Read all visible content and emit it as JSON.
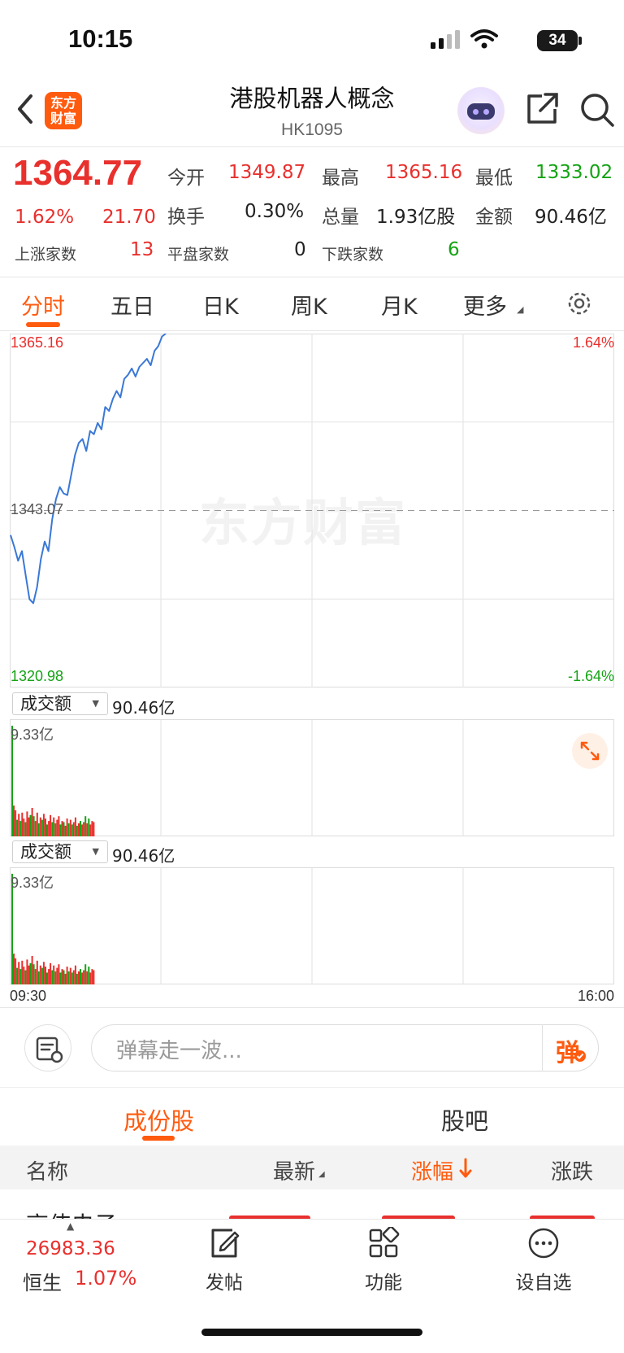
{
  "status_bar": {
    "time": "10:15",
    "battery": "34"
  },
  "header": {
    "logo_text": "东方财富",
    "title": "港股机器人概念",
    "code": "HK1095"
  },
  "quote": {
    "price": "1364.77",
    "change_pct": "1.62%",
    "change": "21.70",
    "open_label": "今开",
    "open": "1349.87",
    "high_label": "最高",
    "high": "1365.16",
    "low_label": "最低",
    "low": "1333.02",
    "turnover_label": "换手",
    "turnover": "0.30%",
    "volume_label": "总量",
    "volume": "1.93亿股",
    "amount_label": "金额",
    "amount": "90.46亿",
    "up_label": "上涨家数",
    "up_count": "13",
    "flat_label": "平盘家数",
    "flat_count": "0",
    "down_label": "下跌家数",
    "down_count": "6"
  },
  "tabs": [
    "分时",
    "五日",
    "日K",
    "周K",
    "月K",
    "更多"
  ],
  "chart_data": {
    "type": "line",
    "ylim": [
      1320.98,
      1365.16
    ],
    "y_top_label": "1365.16",
    "y_mid_label": "1343.07",
    "y_bottom_label": "1320.98",
    "pct_top_label": "1.64%",
    "pct_bottom_label": "-1.64%",
    "x_start_label": "09:30",
    "x_end_label": "16:00",
    "watermark": "东方财富",
    "series": [
      {
        "values": [
          1340.0,
          1338.5,
          1336.8,
          1338.0,
          1335.0,
          1332.0,
          1331.5,
          1333.5,
          1337.0,
          1339.2,
          1338.0,
          1342.0,
          1344.5,
          1346.0,
          1345.2,
          1345.0,
          1347.5,
          1350.0,
          1351.5,
          1352.0,
          1350.5,
          1353.0,
          1352.6,
          1354.0,
          1353.2,
          1356.0,
          1355.5,
          1357.0,
          1358.0,
          1357.2,
          1359.5,
          1360.0,
          1360.8,
          1359.8,
          1361.0,
          1361.5,
          1362.0,
          1361.2,
          1363.0,
          1363.6,
          1364.8,
          1365.16
        ]
      }
    ],
    "volume_panels": [
      {
        "selector": "成交额",
        "total": "90.46亿",
        "max_label": "9.33亿",
        "bars": [
          9.33,
          2.6,
          2.2,
          1.4,
          1.9,
          1.3,
          2.0,
          1.5,
          1.2,
          2.1,
          1.6,
          1.8,
          2.4,
          1.7,
          1.3,
          2.0,
          1.1,
          1.6,
          1.4,
          1.9,
          1.5,
          1.0,
          1.3,
          1.8,
          1.2,
          1.6,
          1.1,
          1.4,
          1.7,
          1.0,
          1.3,
          1.2,
          0.9,
          1.5,
          1.1,
          1.4,
          1.0,
          1.2,
          1.6,
          0.9,
          1.1,
          1.3,
          1.0,
          1.2,
          1.7,
          1.1,
          1.5,
          1.0,
          1.3,
          1.2
        ],
        "bar_colors": [
          "g",
          "r",
          "r",
          "g",
          "r",
          "g",
          "r",
          "r",
          "g",
          "r",
          "r",
          "g",
          "r",
          "g",
          "r",
          "r",
          "g",
          "r",
          "g",
          "r",
          "r",
          "g",
          "r",
          "r",
          "g",
          "r",
          "g",
          "r",
          "r",
          "g",
          "r",
          "g",
          "r",
          "r",
          "g",
          "r",
          "g",
          "r",
          "r",
          "g",
          "r",
          "g",
          "r",
          "r",
          "g",
          "r",
          "g",
          "r",
          "r",
          "r"
        ]
      },
      {
        "selector": "成交额",
        "total": "90.46亿",
        "max_label": "9.33亿",
        "bars": [
          9.33,
          2.6,
          2.2,
          1.4,
          1.9,
          1.3,
          2.0,
          1.5,
          1.2,
          2.1,
          1.6,
          1.8,
          2.4,
          1.7,
          1.3,
          2.0,
          1.1,
          1.6,
          1.4,
          1.9,
          1.5,
          1.0,
          1.3,
          1.8,
          1.2,
          1.6,
          1.1,
          1.4,
          1.7,
          1.0,
          1.3,
          1.2,
          0.9,
          1.5,
          1.1,
          1.4,
          1.0,
          1.2,
          1.6,
          0.9,
          1.1,
          1.3,
          1.0,
          1.2,
          1.7,
          1.1,
          1.5,
          1.0,
          1.3,
          1.2
        ],
        "bar_colors": [
          "g",
          "r",
          "r",
          "g",
          "r",
          "g",
          "r",
          "r",
          "g",
          "r",
          "r",
          "g",
          "r",
          "g",
          "r",
          "r",
          "g",
          "r",
          "g",
          "r",
          "r",
          "g",
          "r",
          "r",
          "g",
          "r",
          "g",
          "r",
          "r",
          "g",
          "r",
          "g",
          "r",
          "r",
          "g",
          "r",
          "g",
          "r",
          "r",
          "g",
          "r",
          "g",
          "r",
          "r",
          "g",
          "r",
          "g",
          "r",
          "r",
          "r"
        ]
      }
    ]
  },
  "danmu": {
    "placeholder": "弹幕走一波...",
    "button": "弹"
  },
  "section_tabs": [
    "成份股",
    "股吧"
  ],
  "table": {
    "headers": [
      "名称",
      "最新",
      "涨幅",
      "涨跌"
    ],
    "first_row_name": "高伟电子"
  },
  "bottom_nav": {
    "index_value": "26983.36",
    "index_name": "恒生",
    "index_change": "1.07%",
    "post": "发帖",
    "function": "功能",
    "watchlist": "设自选"
  },
  "colors": {
    "up": "#e8302d",
    "down": "#14a314",
    "accent": "#ff5b0f",
    "line": "#3a78d6"
  }
}
